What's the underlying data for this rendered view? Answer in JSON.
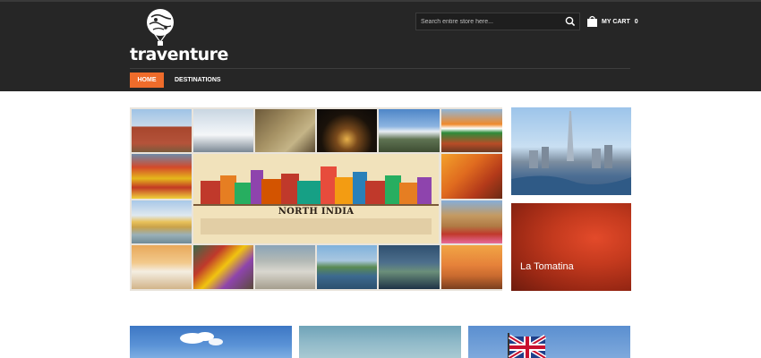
{
  "header": {
    "logo_text": "traventure",
    "search": {
      "placeholder": "Search entire store here..."
    },
    "cart": {
      "label": "MY CART",
      "count": "0"
    }
  },
  "nav": {
    "home_label": "HOME",
    "destinations_label": "DESTINATIONS"
  },
  "collage": {
    "center_label": "NORTH INDIA"
  },
  "side_banners": {
    "tomatina_label": "La Tomatina"
  },
  "colors": {
    "header_bg": "#262626",
    "accent": "#ef6c2b"
  }
}
